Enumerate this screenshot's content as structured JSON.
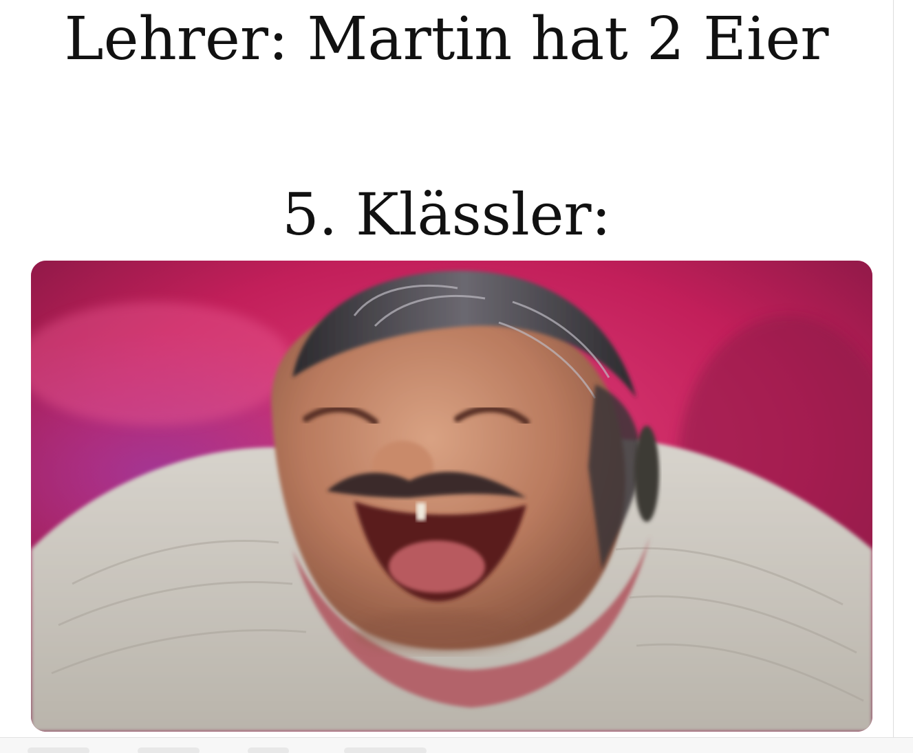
{
  "meme": {
    "caption_top": "Lehrer: Martin hat 2 Eier",
    "caption_bottom": "5. Klässler:",
    "image_subject": "laughing-man-photo",
    "colors": {
      "background": "#ffffff",
      "text": "#111111",
      "photo_backdrop": "#c4245e",
      "sweater": "#cfcbc4"
    }
  }
}
